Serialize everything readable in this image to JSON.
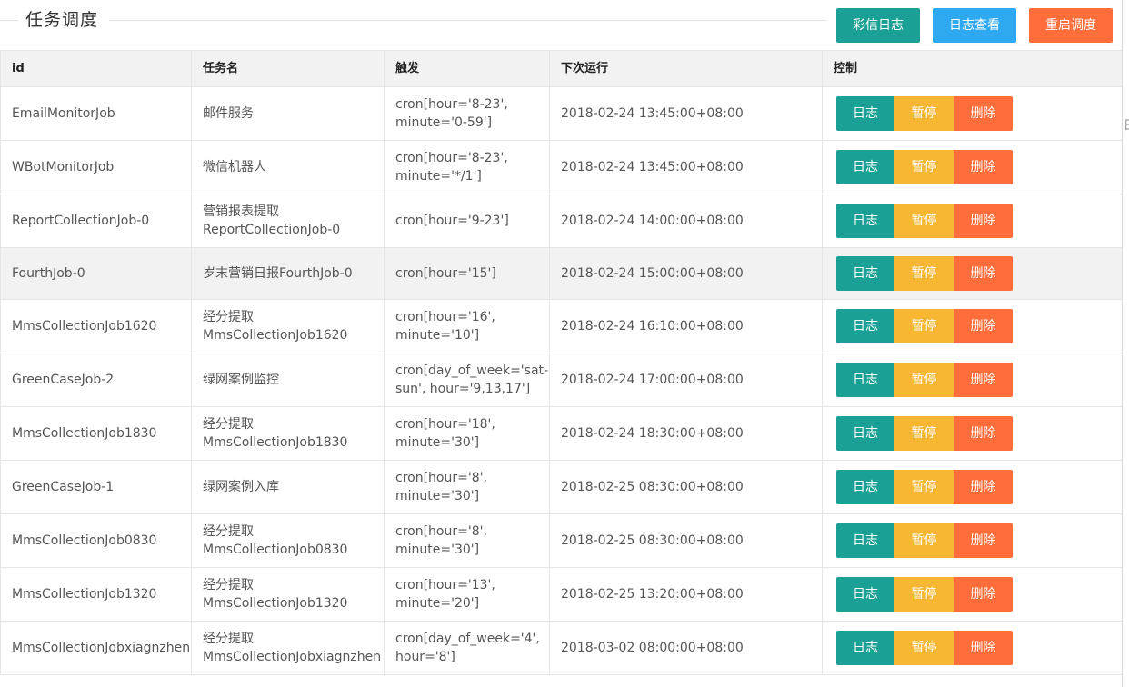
{
  "header": {
    "title": "任务调度"
  },
  "toolbar": {
    "mms_log": "彩信日志",
    "view_log": "日志查看",
    "restart": "重启调度"
  },
  "table": {
    "columns": [
      "id",
      "任务名",
      "触发",
      "下次运行",
      "控制"
    ],
    "action_labels": {
      "log": "日志",
      "pause": "暂停",
      "delete": "删除"
    },
    "rows": [
      {
        "id": "EmailMonitorJob",
        "name": "邮件服务",
        "trigger": "cron[hour='8-23', minute='0-59']",
        "next": "2018-02-24 13:45:00+08:00"
      },
      {
        "id": "WBotMonitorJob",
        "name": "微信机器人",
        "trigger": "cron[hour='8-23', minute='*/1']",
        "next": "2018-02-24 13:45:00+08:00"
      },
      {
        "id": "ReportCollectionJob-0",
        "name": "营销报表提取ReportCollectionJob-0",
        "trigger": "cron[hour='9-23']",
        "next": "2018-02-24 14:00:00+08:00"
      },
      {
        "id": "FourthJob-0",
        "name": "岁末营销日报FourthJob-0",
        "trigger": "cron[hour='15']",
        "next": "2018-02-24 15:00:00+08:00"
      },
      {
        "id": "MmsCollectionJob1620",
        "name": "经分提取MmsCollectionJob1620",
        "trigger": "cron[hour='16', minute='10']",
        "next": "2018-02-24 16:10:00+08:00"
      },
      {
        "id": "GreenCaseJob-2",
        "name": "绿网案例监控",
        "trigger": "cron[day_of_week='sat-sun', hour='9,13,17']",
        "next": "2018-02-24 17:00:00+08:00"
      },
      {
        "id": "MmsCollectionJob1830",
        "name": "经分提取MmsCollectionJob1830",
        "trigger": "cron[hour='18', minute='30']",
        "next": "2018-02-24 18:30:00+08:00"
      },
      {
        "id": "GreenCaseJob-1",
        "name": "绿网案例入库",
        "trigger": "cron[hour='8', minute='30']",
        "next": "2018-02-25 08:30:00+08:00"
      },
      {
        "id": "MmsCollectionJob0830",
        "name": "经分提取MmsCollectionJob0830",
        "trigger": "cron[hour='8', minute='30']",
        "next": "2018-02-25 08:30:00+08:00"
      },
      {
        "id": "MmsCollectionJob1320",
        "name": "经分提取MmsCollectionJob1320",
        "trigger": "cron[hour='13', minute='20']",
        "next": "2018-02-25 13:20:00+08:00"
      },
      {
        "id": "MmsCollectionJobxiagnzhen",
        "name": "经分提取MmsCollectionJobxiagnzhen",
        "trigger": "cron[day_of_week='4', hour='8']",
        "next": "2018-03-02 08:00:00+08:00"
      }
    ]
  },
  "edge": {
    "glyph": "田"
  },
  "colors": {
    "green": "#1aa094",
    "blue": "#2fa8f2",
    "orange": "#ff6d3a",
    "yellow": "#f7b733"
  }
}
